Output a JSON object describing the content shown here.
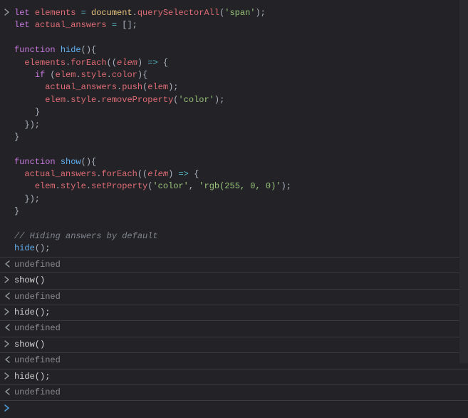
{
  "entries": [
    {
      "kind": "input",
      "html": "<span class='kw'>let</span> <span class='var'>elements</span> <span class='op'>=</span> <span class='obj'>document</span><span class='punc'>.</span><span class='prop'>querySelectorAll</span><span class='punc'>(</span><span class='str'>'span'</span><span class='punc'>);</span>\n<span class='kw'>let</span> <span class='var'>actual_answers</span> <span class='op'>=</span> <span class='punc'>[];</span>\n\n<span class='kw'>function</span> <span class='fn'>hide</span><span class='punc'>(){</span>\n  <span class='var'>elements</span><span class='punc'>.</span><span class='prop'>forEach</span><span class='punc'>((</span><span class='param'>elem</span><span class='punc'>)</span> <span class='op'>=&gt;</span> <span class='punc'>{</span>\n    <span class='kw'>if</span> <span class='punc'>(</span><span class='var'>elem</span><span class='punc'>.</span><span class='prop'>style</span><span class='punc'>.</span><span class='prop'>color</span><span class='punc'>){</span>\n      <span class='var'>actual_answers</span><span class='punc'>.</span><span class='prop'>push</span><span class='punc'>(</span><span class='var'>elem</span><span class='punc'>);</span>\n      <span class='var'>elem</span><span class='punc'>.</span><span class='prop'>style</span><span class='punc'>.</span><span class='prop'>removeProperty</span><span class='punc'>(</span><span class='str'>'color'</span><span class='punc'>);</span>\n    <span class='punc'>}</span>\n  <span class='punc'>});</span>\n<span class='punc'>}</span>\n\n<span class='kw'>function</span> <span class='fn'>show</span><span class='punc'>(){</span>\n  <span class='var'>actual_answers</span><span class='punc'>.</span><span class='prop'>forEach</span><span class='punc'>((</span><span class='param'>elem</span><span class='punc'>)</span> <span class='op'>=&gt;</span> <span class='punc'>{</span>\n    <span class='var'>elem</span><span class='punc'>.</span><span class='prop'>style</span><span class='punc'>.</span><span class='prop'>setProperty</span><span class='punc'>(</span><span class='str'>'color'</span><span class='punc'>,</span> <span class='str'>'rgb(255, 0, 0)'</span><span class='punc'>);</span>\n  <span class='punc'>});</span>\n<span class='punc'>}</span>\n\n<span class='cmt'>// Hiding answers by default</span>\n<span class='fn'>hide</span><span class='punc'>();</span>"
    },
    {
      "kind": "output",
      "text": "undefined"
    },
    {
      "kind": "input",
      "text": "show()"
    },
    {
      "kind": "output",
      "text": "undefined"
    },
    {
      "kind": "input",
      "text": "hide();"
    },
    {
      "kind": "output",
      "text": "undefined"
    },
    {
      "kind": "input",
      "text": "show()"
    },
    {
      "kind": "output",
      "text": "undefined"
    },
    {
      "kind": "input",
      "text": "hide();"
    },
    {
      "kind": "output",
      "text": "undefined"
    }
  ],
  "prompt": ""
}
